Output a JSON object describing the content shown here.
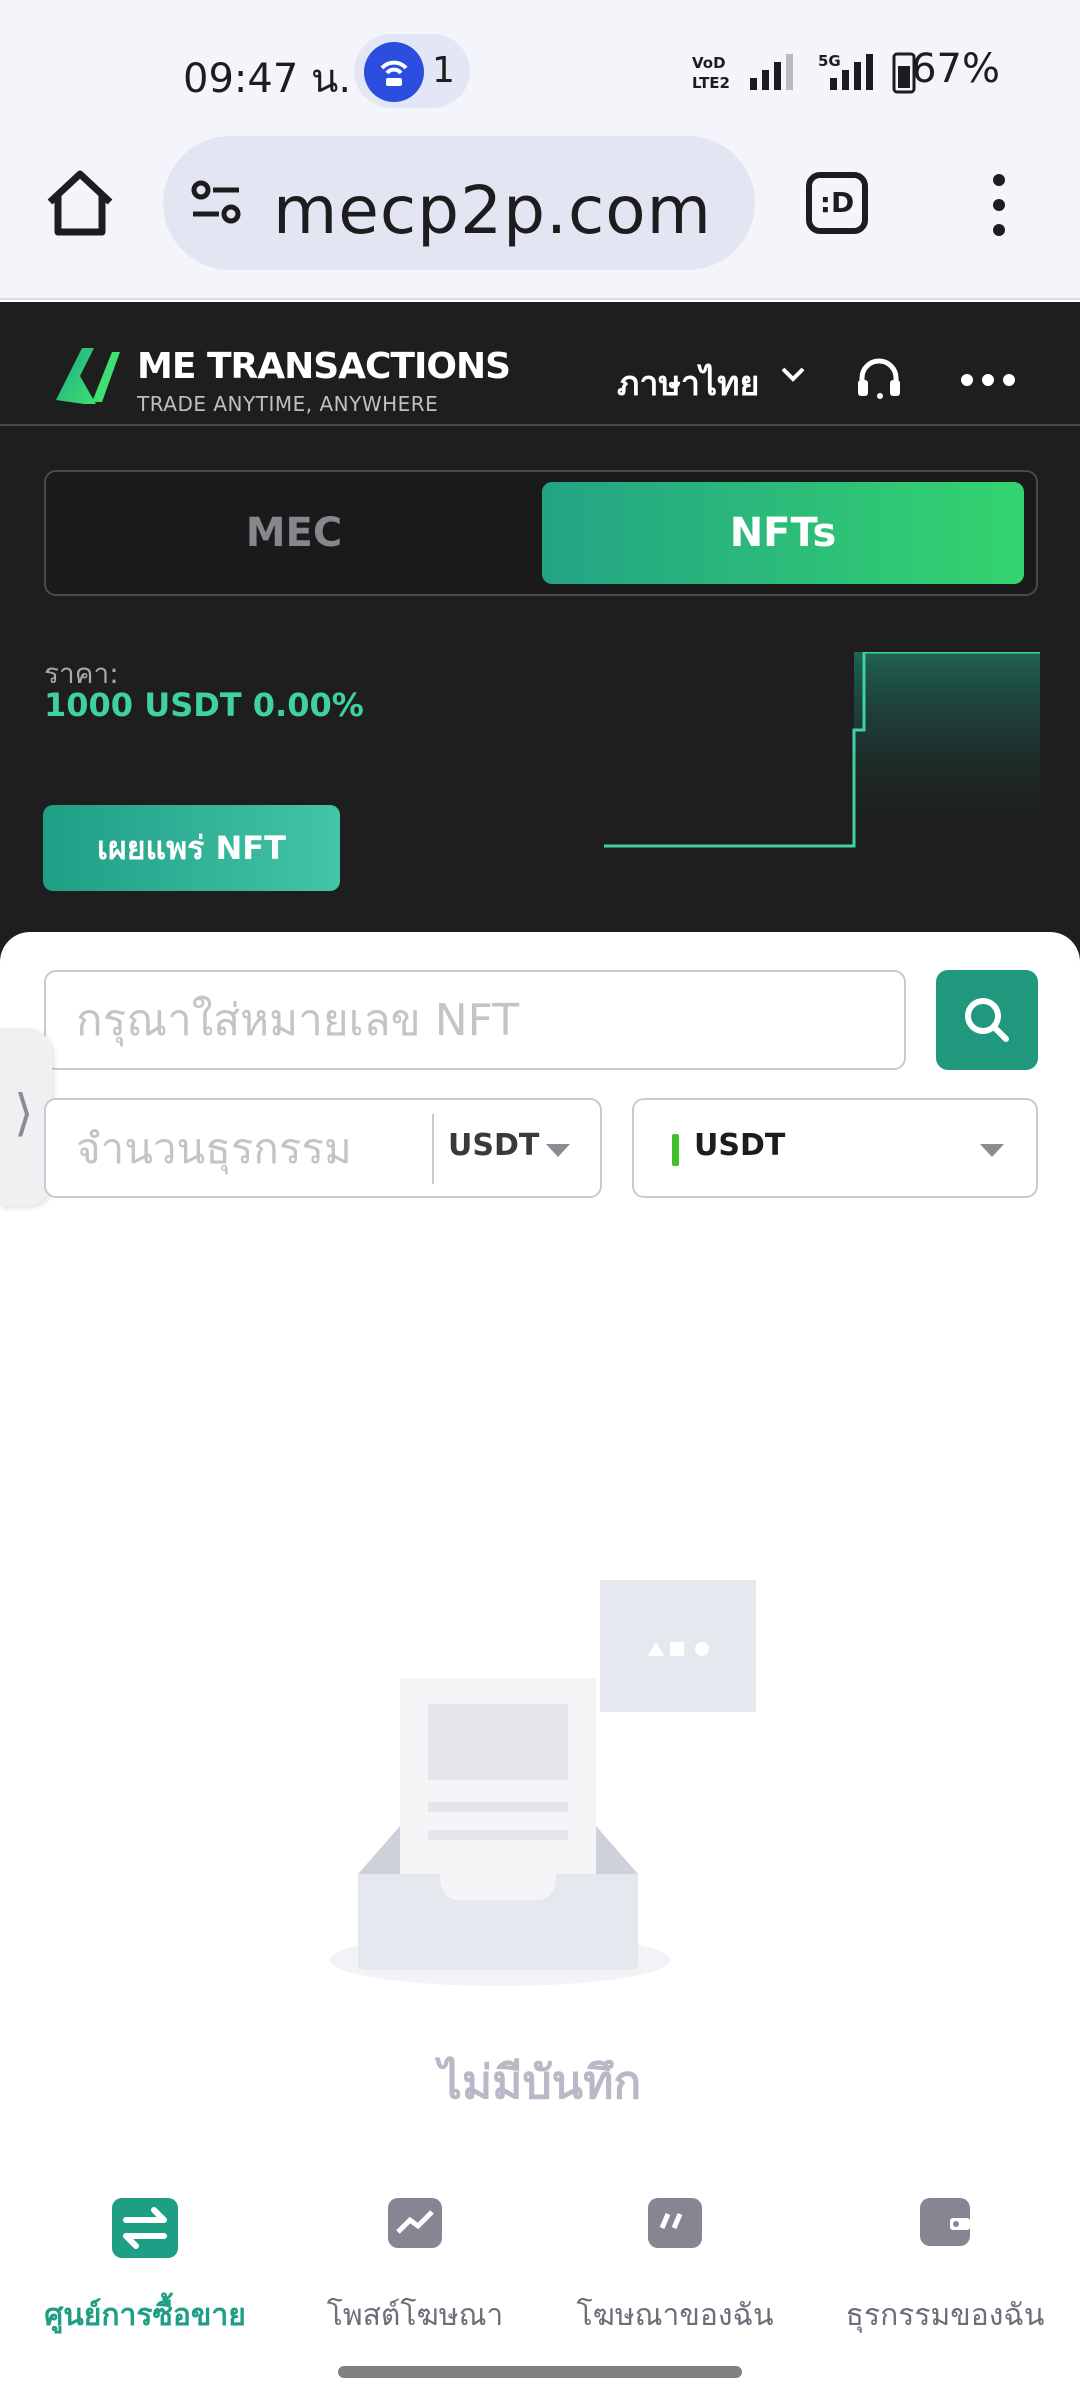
{
  "status_bar": {
    "time": "09:47 น.",
    "notification_count": "1",
    "network_lte": "VoD LTE2",
    "network_5g": "5G",
    "battery": "67%"
  },
  "browser": {
    "url": "mecp2p.com",
    "tabs_label": ":D"
  },
  "app_header": {
    "brand_title": "ME TRANSACTIONS",
    "brand_subtitle": "TRADE ANYTIME, ANYWHERE",
    "language": "ภาษาไทย"
  },
  "switcher": {
    "tabs": [
      {
        "label": "MEC",
        "active": false
      },
      {
        "label": "NFTs",
        "active": true
      }
    ]
  },
  "price": {
    "label": "ราคา:",
    "value": "1000 USDT 0.00%"
  },
  "publish_button": "เผยแพร่ NFT",
  "search": {
    "placeholder": "กรุณาใส่หมายเลข NFT"
  },
  "filters": {
    "amount_placeholder": "จำนวนธุรกรรม",
    "amount_currency": "USDT",
    "coin_selected": "USDT"
  },
  "empty_state": {
    "text": "ไม่มีบันทึก"
  },
  "bottom_nav": {
    "items": [
      {
        "label": "ศูนย์การซื้อขาย",
        "icon": "swap-icon",
        "active": true
      },
      {
        "label": "โพสต์โฆษณา",
        "icon": "chart-post-icon",
        "active": false
      },
      {
        "label": "โฆษณาของฉัน",
        "icon": "my-ads-icon",
        "active": false
      },
      {
        "label": "ธุรกรรมของฉัน",
        "icon": "wallet-icon",
        "active": false
      }
    ]
  },
  "colors": {
    "accent": "#1f9e86",
    "accent_bright": "#34d46f",
    "dark_bg": "#1e1e1f",
    "price_text": "#3fd0a4"
  }
}
